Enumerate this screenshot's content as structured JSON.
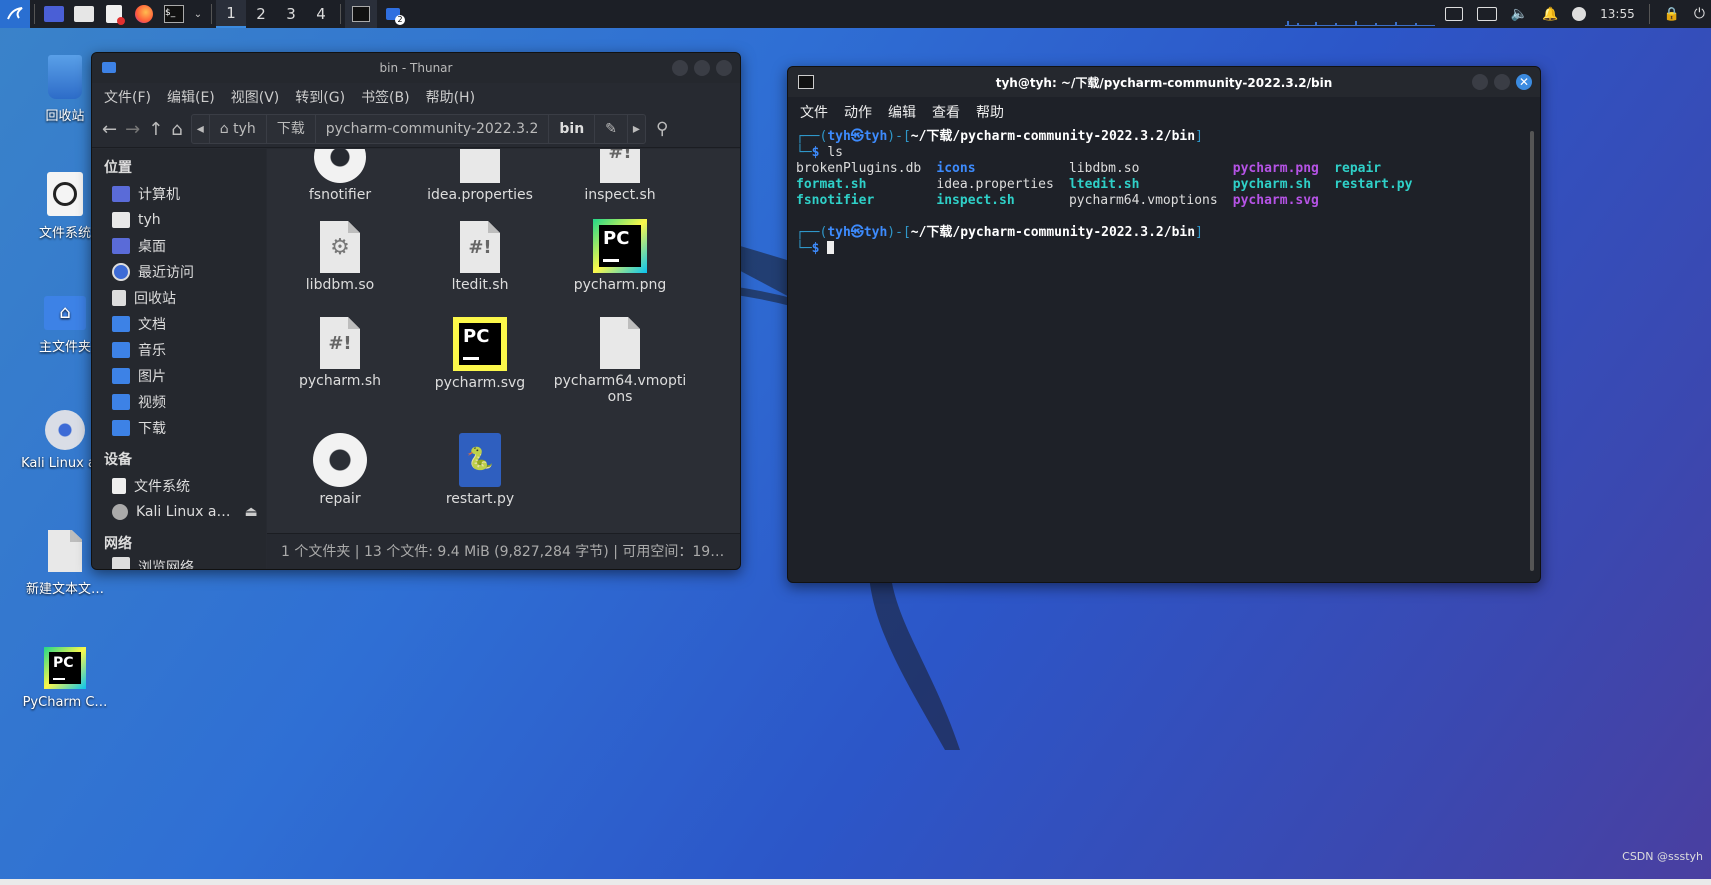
{
  "panel": {
    "workspaces": [
      "1",
      "2",
      "3",
      "4"
    ],
    "badge": "2",
    "clock": "13:55"
  },
  "desktop": {
    "icons": [
      {
        "label": "回收站"
      },
      {
        "label": "文件系统"
      },
      {
        "label": "主文件夹"
      },
      {
        "label": "Kali Linux a…"
      },
      {
        "label": "新建文本文…"
      },
      {
        "label": "PyCharm C…"
      }
    ]
  },
  "thunar": {
    "title": "bin - Thunar",
    "menu": [
      "文件(F)",
      "编辑(E)",
      "视图(V)",
      "转到(G)",
      "书签(B)",
      "帮助(H)"
    ],
    "breadcrumb": [
      "tyh",
      "下载",
      "pycharm-community-2022.3.2",
      "bin"
    ],
    "sidebar": {
      "places_header": "位置",
      "places": [
        "计算机",
        "tyh",
        "桌面",
        "最近访问",
        "回收站",
        "文档",
        "音乐",
        "图片",
        "视频",
        "下载"
      ],
      "devices_header": "设备",
      "devices": [
        "文件系统",
        "Kali Linux a…"
      ],
      "network_header": "网络",
      "network_partial": "浏览网络"
    },
    "files": [
      {
        "name": "fsnotifier",
        "type": "gear"
      },
      {
        "name": "idea.properties",
        "type": "text"
      },
      {
        "name": "inspect.sh",
        "type": "script"
      },
      {
        "name": "libdbm.so",
        "type": "lib"
      },
      {
        "name": "ltedit.sh",
        "type": "script"
      },
      {
        "name": "pycharm.png",
        "type": "pc"
      },
      {
        "name": "pycharm.sh",
        "type": "script"
      },
      {
        "name": "pycharm.svg",
        "type": "pc-svg"
      },
      {
        "name": "pycharm64.vmoptions",
        "type": "text"
      },
      {
        "name": "repair",
        "type": "gear"
      },
      {
        "name": "restart.py",
        "type": "python"
      }
    ],
    "status": "1 个文件夹 | 13 个文件: 9.4 MiB (9,827,284 字节) | 可用空间：19…"
  },
  "terminal": {
    "title": "tyh@tyh: ~/下载/pycharm-community-2022.3.2/bin",
    "menu": [
      "文件",
      "动作",
      "编辑",
      "查看",
      "帮助"
    ],
    "user": "tyh",
    "at": "㉿",
    "host": "tyh",
    "path": "~/下载/pycharm-community-2022.3.2/bin",
    "command": "ls",
    "ls_rows": [
      [
        {
          "t": "brokenPlugins.db",
          "c": ""
        },
        {
          "t": "icons",
          "c": "blue"
        },
        {
          "t": "libdbm.so",
          "c": ""
        },
        {
          "t": "pycharm.png",
          "c": "pur"
        },
        {
          "t": "repair",
          "c": "cyan"
        }
      ],
      [
        {
          "t": "format.sh",
          "c": "cyan"
        },
        {
          "t": "idea.properties",
          "c": ""
        },
        {
          "t": "ltedit.sh",
          "c": "cyan"
        },
        {
          "t": "pycharm.sh",
          "c": "cyan"
        },
        {
          "t": "restart.py",
          "c": "cyan"
        }
      ],
      [
        {
          "t": "fsnotifier",
          "c": "cyan"
        },
        {
          "t": "inspect.sh",
          "c": "cyan"
        },
        {
          "t": "pycharm64.vmoptions",
          "c": ""
        },
        {
          "t": "pycharm.svg",
          "c": "pur"
        },
        {
          "t": "",
          "c": ""
        }
      ]
    ]
  },
  "watermark": "CSDN @ssstyh"
}
